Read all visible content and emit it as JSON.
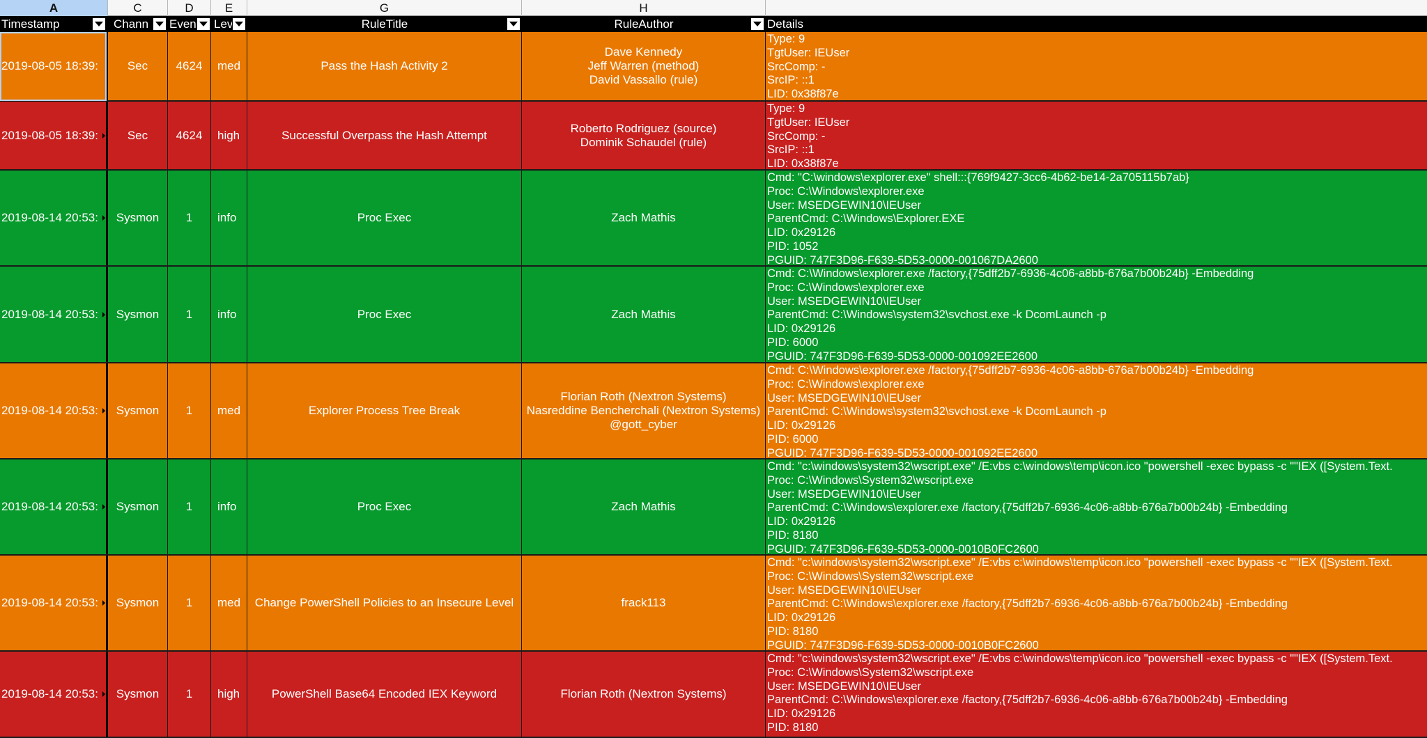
{
  "column_letters": [
    "A",
    "C",
    "D",
    "E",
    "G",
    "H",
    ""
  ],
  "selected_column": "A",
  "headers": {
    "timestamp": "Timestamp",
    "channel": "Chann",
    "event": "Even",
    "level": "Lev",
    "rule_title": "RuleTitle",
    "rule_author": "RuleAuthor",
    "details": "Details"
  },
  "level_colors": {
    "med": "#E97800",
    "high": "#C8201F",
    "info": "#079A2C"
  },
  "rows": [
    {
      "timestamp": "2019-08-05 18:39:",
      "channel": "Sec",
      "event": "4624",
      "level": "med",
      "rule_title": "Pass the Hash Activity 2",
      "rule_author": [
        "Dave Kennedy",
        "Jeff Warren (method)",
        "David Vassallo (rule)"
      ],
      "details": [
        "Type: 9",
        "TgtUser: IEUser",
        "SrcComp: -",
        "SrcIP: ::1",
        "LID: 0x38f87e"
      ]
    },
    {
      "timestamp": "2019-08-05 18:39:",
      "channel": "Sec",
      "event": "4624",
      "level": "high",
      "rule_title": "Successful Overpass the Hash Attempt",
      "rule_author": [
        "Roberto Rodriguez (source)",
        "Dominik Schaudel (rule)"
      ],
      "details": [
        "Type: 9",
        "TgtUser: IEUser",
        "SrcComp: -",
        "SrcIP: ::1",
        "LID: 0x38f87e"
      ]
    },
    {
      "timestamp": "2019-08-14 20:53:",
      "channel": "Sysmon",
      "event": "1",
      "level": "info",
      "rule_title": "Proc Exec",
      "rule_author": [
        "Zach Mathis"
      ],
      "details": [
        "Cmd: \"C:\\windows\\explorer.exe\" shell:::{769f9427-3cc6-4b62-be14-2a705115b7ab}",
        "Proc: C:\\Windows\\explorer.exe",
        "User: MSEDGEWIN10\\IEUser",
        "ParentCmd: C:\\Windows\\Explorer.EXE",
        "LID: 0x29126",
        "PID: 1052",
        "PGUID: 747F3D96-F639-5D53-0000-001067DA2600"
      ]
    },
    {
      "timestamp": "2019-08-14 20:53:",
      "channel": "Sysmon",
      "event": "1",
      "level": "info",
      "rule_title": "Proc Exec",
      "rule_author": [
        "Zach Mathis"
      ],
      "details": [
        "Cmd: C:\\Windows\\explorer.exe /factory,{75dff2b7-6936-4c06-a8bb-676a7b00b24b} -Embedding",
        "Proc: C:\\Windows\\explorer.exe",
        "User: MSEDGEWIN10\\IEUser",
        "ParentCmd: C:\\Windows\\system32\\svchost.exe -k DcomLaunch -p",
        "LID: 0x29126",
        "PID: 6000",
        "PGUID: 747F3D96-F639-5D53-0000-001092EE2600"
      ]
    },
    {
      "timestamp": "2019-08-14 20:53:",
      "channel": "Sysmon",
      "event": "1",
      "level": "med",
      "rule_title": "Explorer Process Tree Break",
      "rule_author": [
        "Florian Roth (Nextron Systems)",
        "Nasreddine Bencherchali (Nextron Systems)",
        "@gott_cyber"
      ],
      "details": [
        "Cmd: C:\\Windows\\explorer.exe /factory,{75dff2b7-6936-4c06-a8bb-676a7b00b24b} -Embedding",
        "Proc: C:\\Windows\\explorer.exe",
        "User: MSEDGEWIN10\\IEUser",
        "ParentCmd: C:\\Windows\\system32\\svchost.exe -k DcomLaunch -p",
        "LID: 0x29126",
        "PID: 6000",
        "PGUID: 747F3D96-F639-5D53-0000-001092EE2600"
      ]
    },
    {
      "timestamp": "2019-08-14 20:53:",
      "channel": "Sysmon",
      "event": "1",
      "level": "info",
      "rule_title": "Proc Exec",
      "rule_author": [
        "Zach Mathis"
      ],
      "details": [
        "Cmd: \"c:\\windows\\system32\\wscript.exe\" /E:vbs c:\\windows\\temp\\icon.ico \"powershell -exec bypass -c \"\"IEX ([System.Text.",
        "Proc: C:\\Windows\\System32\\wscript.exe",
        "User: MSEDGEWIN10\\IEUser",
        "ParentCmd: C:\\Windows\\explorer.exe /factory,{75dff2b7-6936-4c06-a8bb-676a7b00b24b} -Embedding",
        "LID: 0x29126",
        "PID: 8180",
        "PGUID: 747F3D96-F639-5D53-0000-0010B0FC2600"
      ]
    },
    {
      "timestamp": "2019-08-14 20:53:",
      "channel": "Sysmon",
      "event": "1",
      "level": "med",
      "rule_title": "Change PowerShell Policies to an Insecure Level",
      "rule_author": [
        "frack113"
      ],
      "details": [
        "Cmd: \"c:\\windows\\system32\\wscript.exe\" /E:vbs c:\\windows\\temp\\icon.ico \"powershell -exec bypass -c \"\"IEX ([System.Text.",
        "Proc: C:\\Windows\\System32\\wscript.exe",
        "User: MSEDGEWIN10\\IEUser",
        "ParentCmd: C:\\Windows\\explorer.exe /factory,{75dff2b7-6936-4c06-a8bb-676a7b00b24b} -Embedding",
        "LID: 0x29126",
        "PID: 8180",
        "PGUID: 747F3D96-F639-5D53-0000-0010B0FC2600"
      ]
    },
    {
      "timestamp": "2019-08-14 20:53:",
      "channel": "Sysmon",
      "event": "1",
      "level": "high",
      "rule_title": "PowerShell Base64 Encoded IEX Keyword",
      "rule_author": [
        "Florian Roth (Nextron Systems)"
      ],
      "details": [
        "Cmd: \"c:\\windows\\system32\\wscript.exe\" /E:vbs c:\\windows\\temp\\icon.ico \"powershell -exec bypass -c \"\"IEX ([System.Text.",
        "Proc: C:\\Windows\\System32\\wscript.exe",
        "User: MSEDGEWIN10\\IEUser",
        "ParentCmd: C:\\Windows\\explorer.exe /factory,{75dff2b7-6936-4c06-a8bb-676a7b00b24b} -Embedding",
        "LID: 0x29126",
        "PID: 8180"
      ]
    }
  ]
}
